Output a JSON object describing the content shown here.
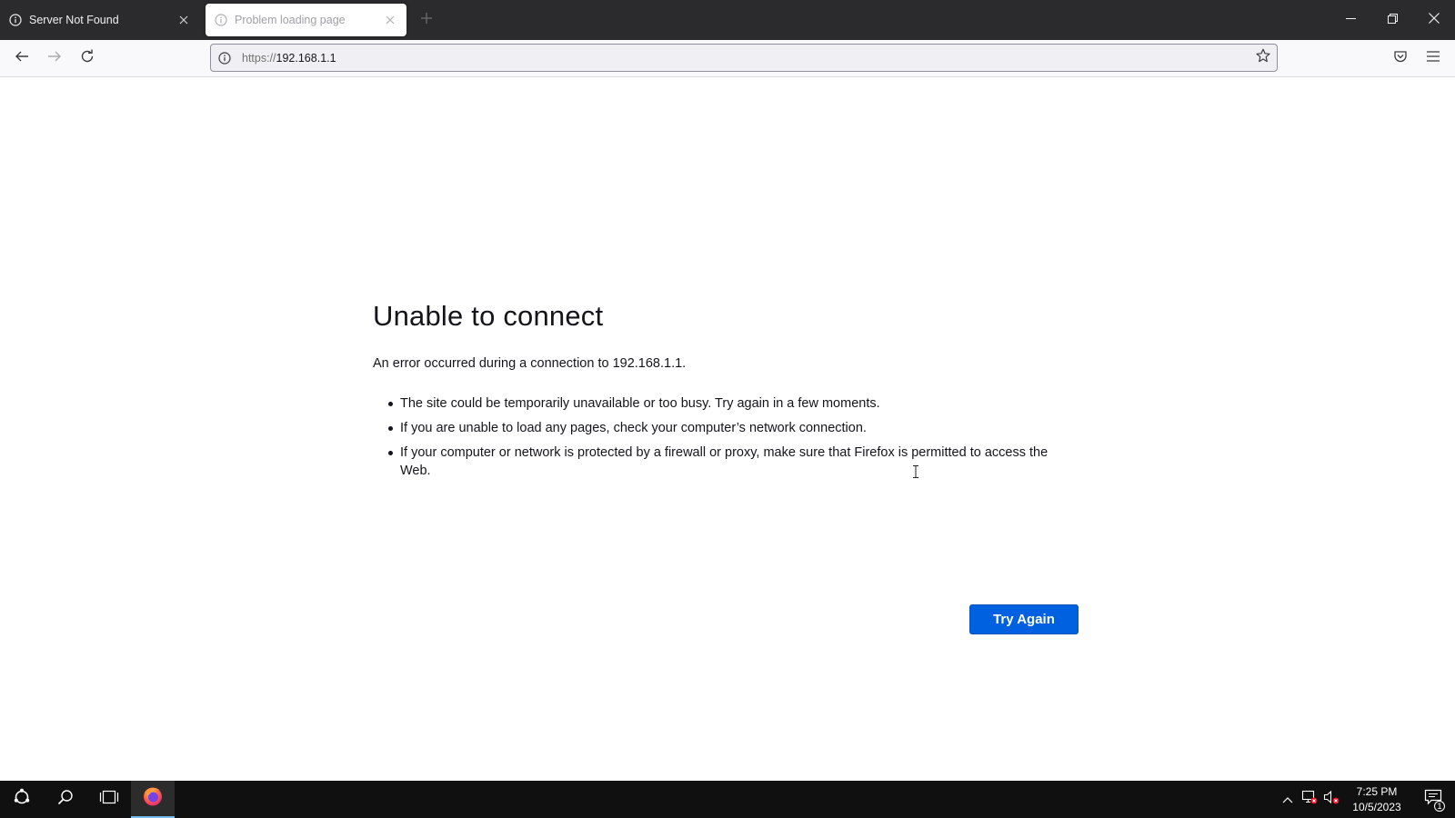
{
  "browser": {
    "tabs": [
      {
        "title": "Server Not Found",
        "icon": "info-icon",
        "active": false
      },
      {
        "title": "Problem loading page",
        "icon": "info-icon",
        "active": true
      }
    ],
    "new_tab_icon": "plus-icon",
    "window_controls": [
      "minimize-icon",
      "restore-icon",
      "close-icon"
    ]
  },
  "navbar": {
    "back_icon": "back-arrow-icon",
    "forward_icon": "forward-arrow-icon",
    "reload_icon": "reload-icon",
    "url_scheme": "https://",
    "url_host": "192.168.1.1",
    "bookmark_icon": "star-icon",
    "pocket_icon": "pocket-icon",
    "menu_icon": "hamburger-menu-icon"
  },
  "error_page": {
    "title": "Unable to connect",
    "description": "An error occurred during a connection to 192.168.1.1.",
    "bullets": [
      "The site could be temporarily unavailable or too busy. Try again in a few moments.",
      "If you are unable to load any pages, check your computer’s network connection.",
      "If your computer or network is protected by a firewall or proxy, make sure that Firefox is permitted to access the Web."
    ],
    "try_again_label": "Try Again"
  },
  "taskbar": {
    "start_icon": "start-icon",
    "search_icon": "search-icon",
    "task_view_icon": "task-view-icon",
    "pinned_app": "firefox-icon",
    "tray_icons": [
      "chevron-up-icon",
      "network-disconnected-icon",
      "volume-muted-icon"
    ],
    "time": "7:25 PM",
    "date": "10/5/2023",
    "notification_count": "1"
  },
  "colors": {
    "tabstrip_bg": "#2b2b2e",
    "navbar_bg": "#f9f9fb",
    "button_blue": "#0061e0",
    "taskbar_bg": "#101010"
  }
}
